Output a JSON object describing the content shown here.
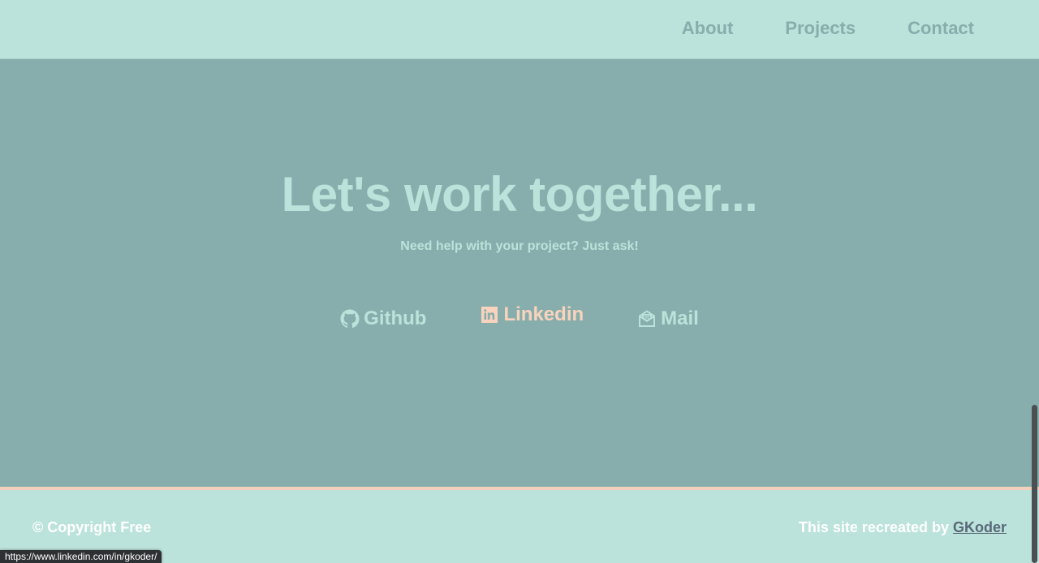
{
  "nav": {
    "items": [
      {
        "label": "About"
      },
      {
        "label": "Projects"
      },
      {
        "label": "Contact"
      }
    ]
  },
  "hero": {
    "title": "Let's work together...",
    "subtitle": "Need help with your project? Just ask!",
    "social": [
      {
        "label": "Github",
        "icon": "github-icon"
      },
      {
        "label": "Linkedin",
        "icon": "linkedin-icon",
        "state": "hovered"
      },
      {
        "label": "Mail",
        "icon": "envelope-open-icon"
      }
    ]
  },
  "footer": {
    "copyright": "© Copyright Free",
    "credit_prefix": "This site recreated by ",
    "credit_link": "GKoder"
  },
  "status_bar": {
    "url": "https://www.linkedin.com/in/gkoder/"
  },
  "colors": {
    "nav_bg": "#bbe3db",
    "hero_bg": "#87aeac",
    "accent_text": "#bbe3db",
    "hover_accent": "#f9d3bd",
    "footer_border": "#f3cfbd",
    "credit_link": "#596878"
  }
}
